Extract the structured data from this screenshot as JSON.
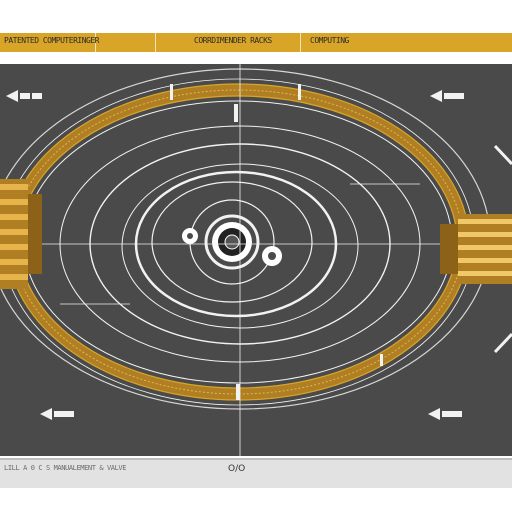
{
  "top_bar": {
    "left_text": "PATENTED COMPUTERINGER",
    "center_text": "CORRDIMENDER RACKS",
    "right_text": "COMPUTING"
  },
  "bottom_bar": {
    "left_text": "LILL A 0 C S MANUALEMENT & VALVE",
    "center_label": "O/O"
  },
  "colors": {
    "panel": "#4a4a4a",
    "accent_gold": "#d9a528",
    "line_white": "#f2f2f2"
  }
}
